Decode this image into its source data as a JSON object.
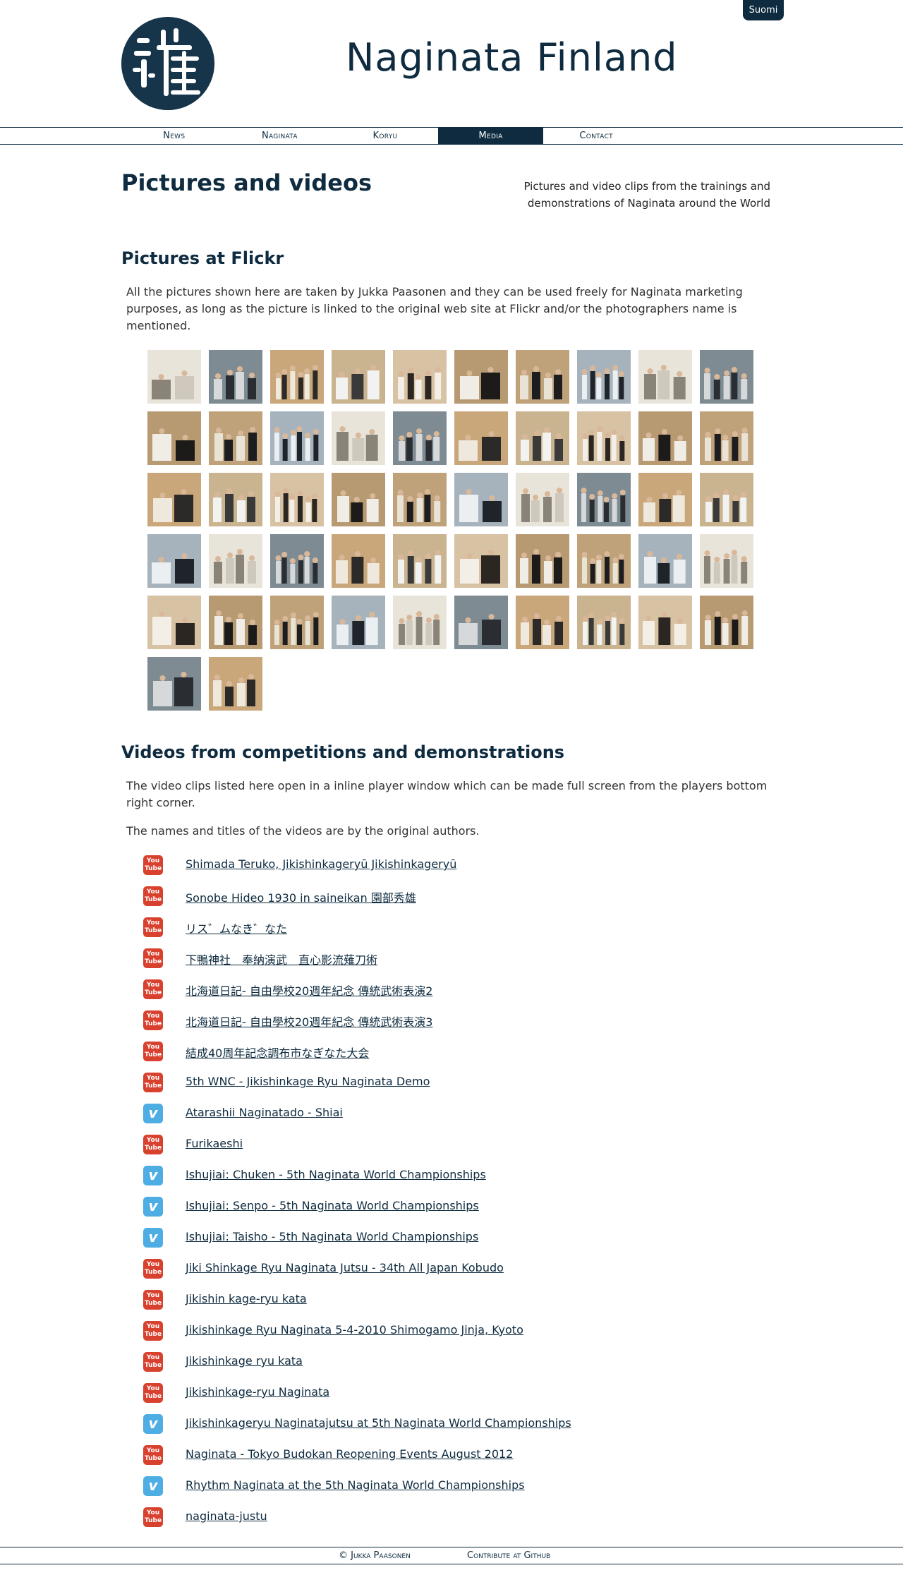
{
  "header": {
    "site_title": "Naginata Finland",
    "language_button": "Suomi",
    "logo_icon": "naginata-kanji-logo-icon"
  },
  "nav": {
    "items": [
      {
        "label": "News",
        "active": false
      },
      {
        "label": "Naginata",
        "active": false
      },
      {
        "label": "Koryu",
        "active": false
      },
      {
        "label": "Media",
        "active": true
      },
      {
        "label": "Contact",
        "active": false
      }
    ]
  },
  "page": {
    "title": "Pictures and videos",
    "description": "Pictures and video clips from the trainings and demonstrations of Naginata around the World"
  },
  "flickr": {
    "heading": "Pictures at Flickr",
    "intro": "All the pictures shown here are taken by Jukka Paasonen and they can be used freely for Naginata marketing purposes, as long as the picture is linked to the original web site at Flickr and/or the photographers name is mentioned.",
    "photo_count": 52
  },
  "videos": {
    "heading": "Videos from competitions and demonstrations",
    "intro": "The video clips listed here open in a inline player window which can be made full screen from the players bottom right corner.",
    "note": "The names and titles of the videos are by the original authors.",
    "items": [
      {
        "title": "Shimada Teruko, Jikishinkageryū Jikishinkageryū",
        "source": "youtube"
      },
      {
        "title": "Sonobe Hideo 1930 in saineikan 園部秀雄",
        "source": "youtube"
      },
      {
        "title": "リス゛ムなき゛なた",
        "source": "youtube"
      },
      {
        "title": "下鴨神社　奉納演武　直心影流薙刀術",
        "source": "youtube"
      },
      {
        "title": "北海道日記- 自由學校20週年紀念 傳統武術表演2",
        "source": "youtube"
      },
      {
        "title": "北海道日記- 自由學校20週年紀念 傳統武術表演3",
        "source": "youtube"
      },
      {
        "title": "結成40周年記念調布市なぎなた大会",
        "source": "youtube"
      },
      {
        "title": "5th WNC - Jikishinkage Ryu Naginata Demo",
        "source": "youtube"
      },
      {
        "title": "Atarashii Naginatado - Shiai",
        "source": "vimeo"
      },
      {
        "title": "Furikaeshi",
        "source": "youtube"
      },
      {
        "title": "Ishujiai: Chuken - 5th Naginata World Championships",
        "source": "vimeo"
      },
      {
        "title": "Ishujiai: Senpo - 5th Naginata World Championships",
        "source": "vimeo"
      },
      {
        "title": "Ishujiai: Taisho - 5th Naginata World Championships",
        "source": "vimeo"
      },
      {
        "title": "Jiki Shinkage Ryu Naginata Jutsu - 34th All Japan Kobudo",
        "source": "youtube"
      },
      {
        "title": "Jikishin kage-ryu kata",
        "source": "youtube"
      },
      {
        "title": "Jikishinkage Ryu Naginata 5-4-2010 Shimogamo Jinja, Kyoto",
        "source": "youtube"
      },
      {
        "title": "Jikishinkage ryu kata",
        "source": "youtube"
      },
      {
        "title": "Jikishinkage-ryu Naginata",
        "source": "youtube"
      },
      {
        "title": "Jikishinkageryu Naginatajutsu at 5th Naginata World Championships",
        "source": "vimeo"
      },
      {
        "title": "Naginata - Tokyo Budokan Reopening Events August 2012",
        "source": "youtube"
      },
      {
        "title": "Rhythm Naginata at the 5th Naginata World Championships",
        "source": "vimeo"
      },
      {
        "title": "naginata-justu",
        "source": "youtube"
      }
    ],
    "icon_labels": {
      "youtube": "You Tube",
      "vimeo": "v"
    }
  },
  "footer": {
    "copyright": "© Jukka Paasonen",
    "github_link": "Contribute at Github"
  },
  "colors": {
    "brand": "#0e2b3f",
    "youtube": "#d9412f",
    "vimeo": "#4eaee3"
  }
}
